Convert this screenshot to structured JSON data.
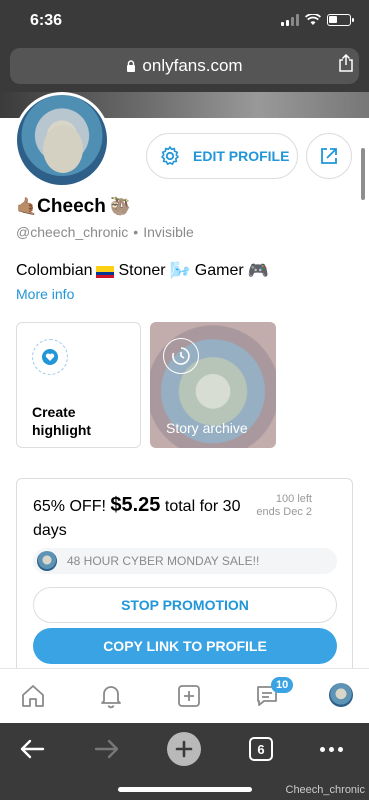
{
  "status": {
    "time": "6:36"
  },
  "browser": {
    "url": "onlyfans.com",
    "tab_count": "6"
  },
  "profile": {
    "name": "Cheech",
    "name_emoji_left": "🤙🏽",
    "name_emoji_right": "🦥",
    "handle": "@cheech_chronic",
    "status": "Invisible",
    "bio_part1": "Colombian",
    "bio_part2": "Stoner",
    "bio_emoji2": "🌬️",
    "bio_part3": "Gamer",
    "bio_emoji3": "🎮",
    "more_info": "More info"
  },
  "actions": {
    "edit_profile": "EDIT PROFILE"
  },
  "highlights": {
    "create": "Create highlight",
    "story_archive": "Story archive"
  },
  "promo": {
    "discount": "65% OFF!",
    "price": "$5.25",
    "suffix": "total for 30 days",
    "left_count": "100 left",
    "ends": "ends Dec 2",
    "sale_label": "48 HOUR CYBER MONDAY SALE!!",
    "stop": "STOP PROMOTION",
    "copy": "COPY LINK TO PROFILE"
  },
  "nav": {
    "messages_badge": "10"
  },
  "watermark": "Cheech_chronic",
  "colors": {
    "accent": "#2196d8",
    "button_fill": "#3aa3e3",
    "chrome": "#3a3a3a"
  }
}
